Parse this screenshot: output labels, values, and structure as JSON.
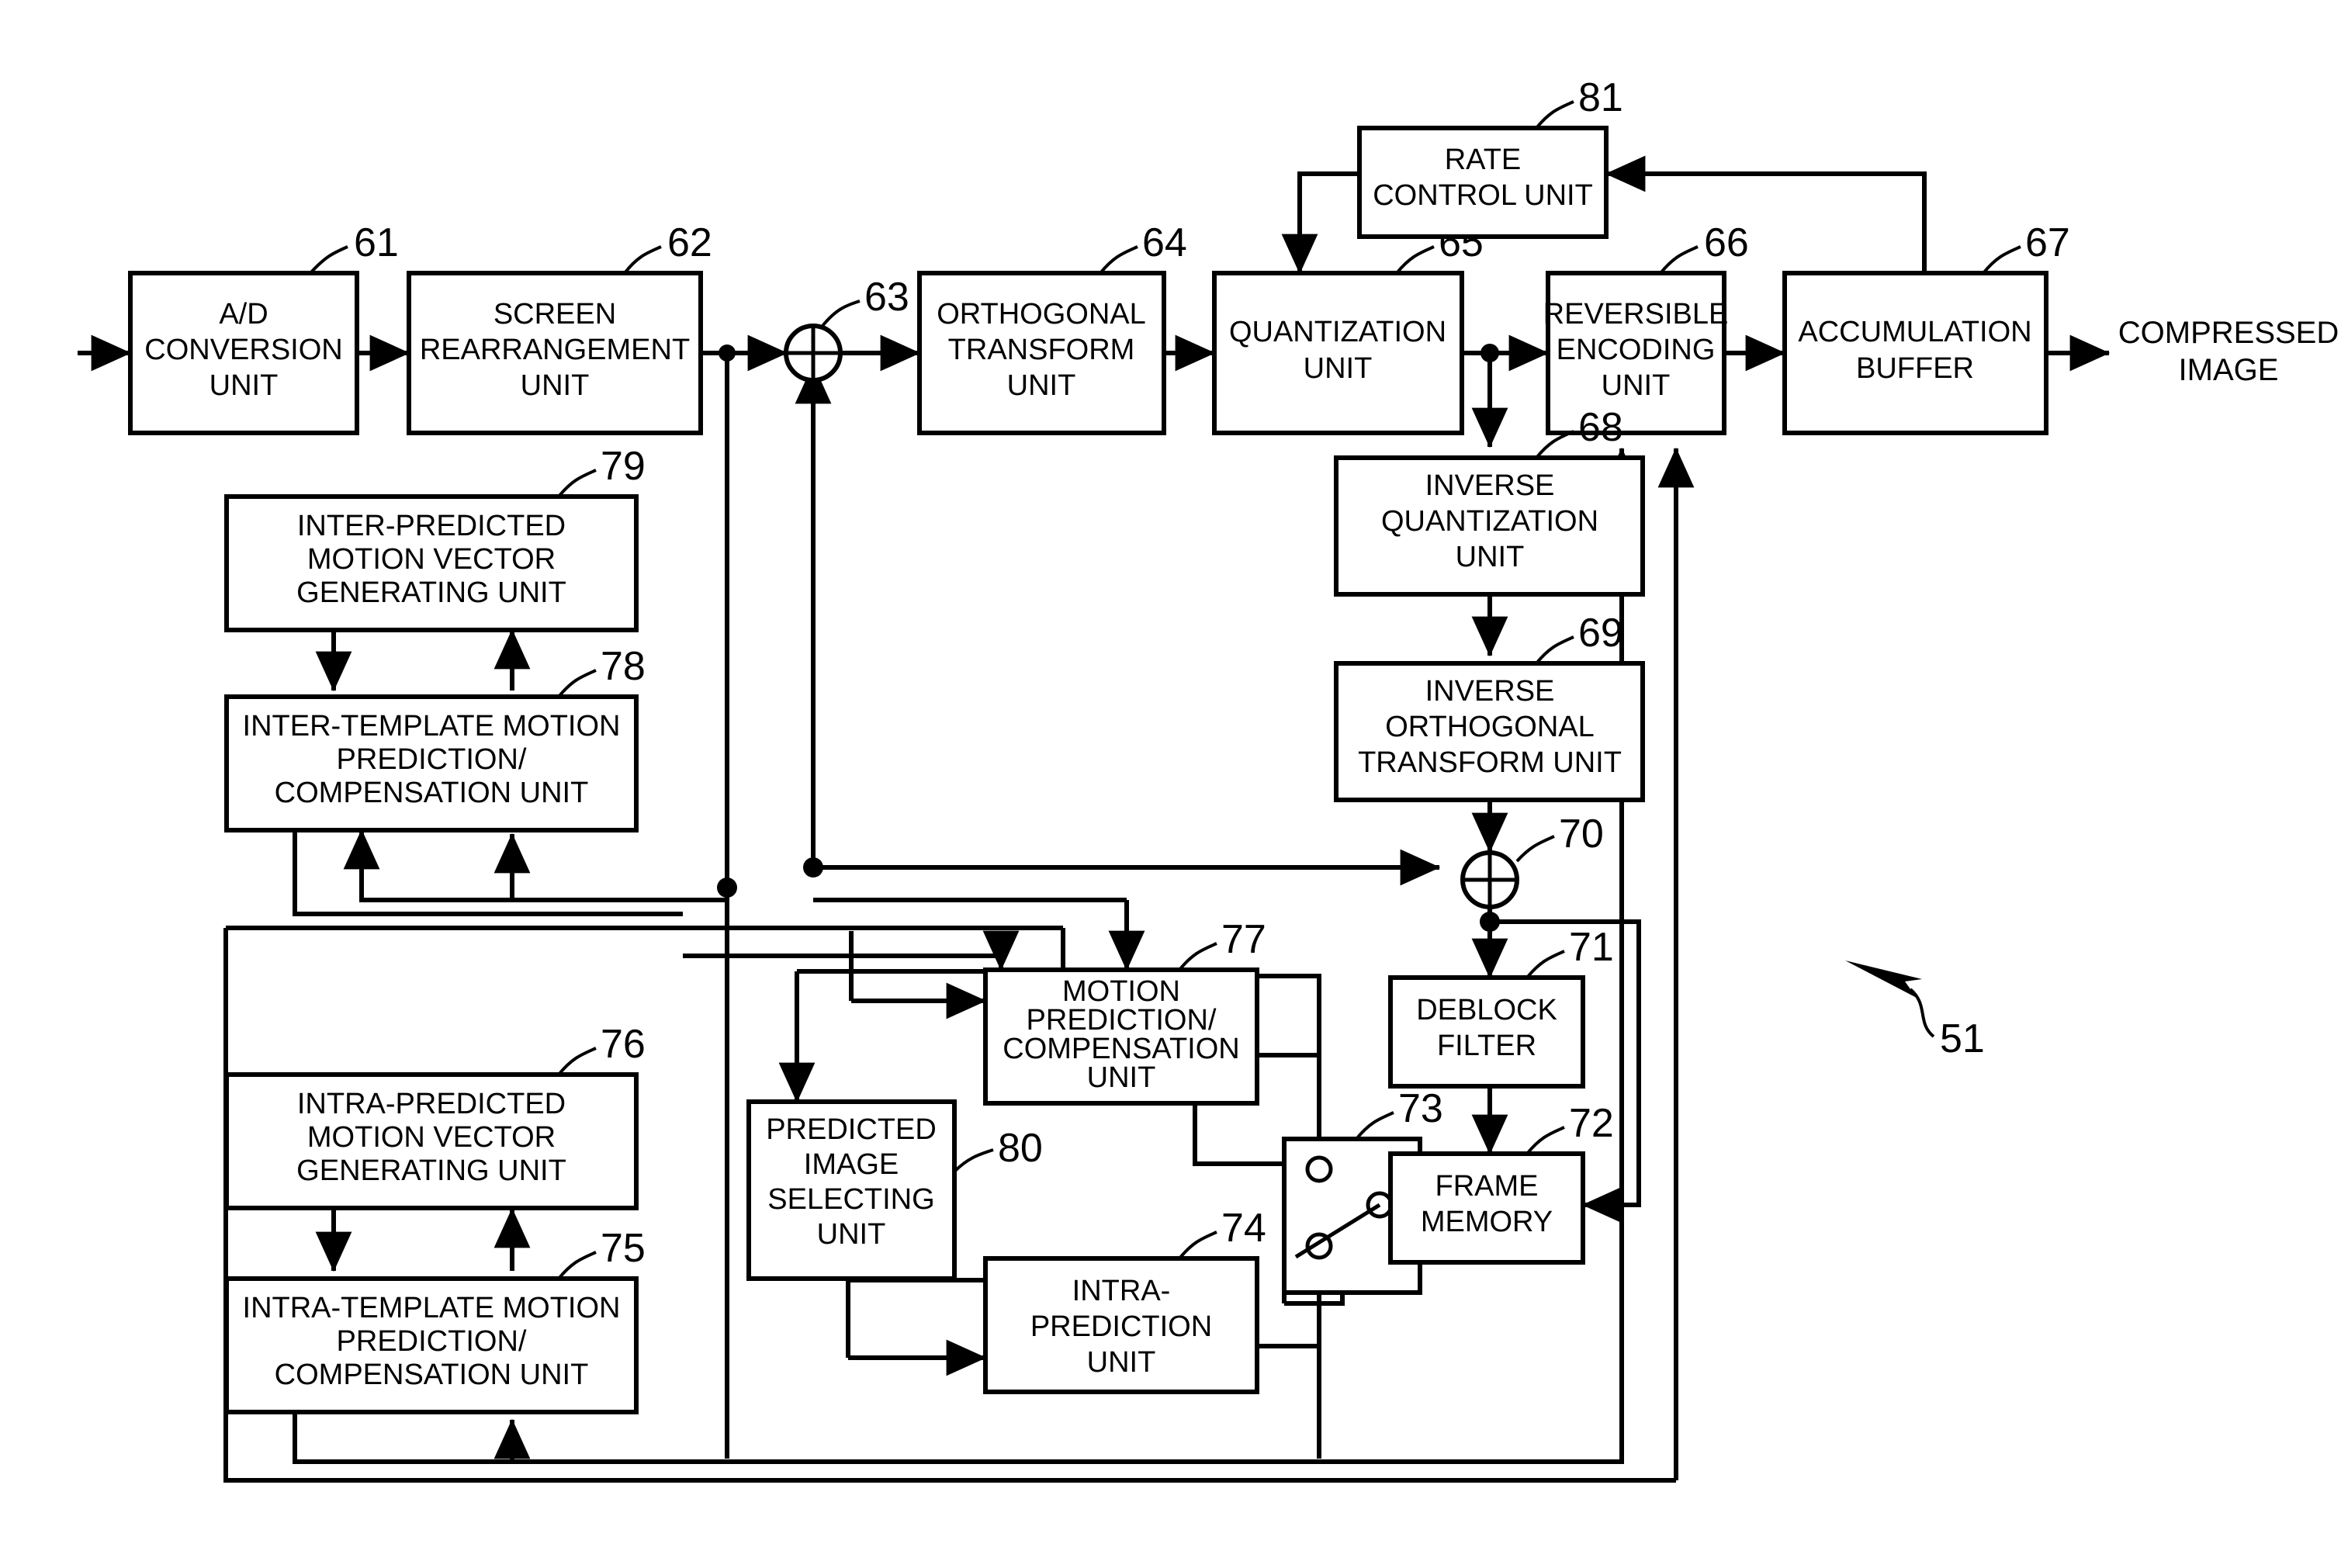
{
  "figure": {
    "reference_numeral": "51",
    "external_labels": [
      {
        "id": "compressed-image",
        "text_line1": "COMPRESSED",
        "text_line2": "IMAGE"
      }
    ]
  },
  "blocks": [
    {
      "id": "ad-conversion-unit",
      "num": "61",
      "lines": [
        "A/D",
        "CONVERSION",
        "UNIT"
      ]
    },
    {
      "id": "screen-rearrangement-unit",
      "num": "62",
      "lines": [
        "SCREEN",
        "REARRANGEMENT",
        "UNIT"
      ]
    },
    {
      "id": "orthogonal-transform-unit",
      "num": "64",
      "lines": [
        "ORTHOGONAL",
        "TRANSFORM",
        "UNIT"
      ]
    },
    {
      "id": "quantization-unit",
      "num": "65",
      "lines": [
        "QUANTIZATION",
        "UNIT"
      ]
    },
    {
      "id": "reversible-encoding-unit",
      "num": "66",
      "lines": [
        "REVERSIBLE",
        "ENCODING",
        "UNIT"
      ]
    },
    {
      "id": "accumulation-buffer",
      "num": "67",
      "lines": [
        "ACCUMULATION",
        "BUFFER"
      ]
    },
    {
      "id": "rate-control-unit",
      "num": "81",
      "lines": [
        "RATE",
        "CONTROL UNIT"
      ]
    },
    {
      "id": "inverse-quantization-unit",
      "num": "68",
      "lines": [
        "INVERSE",
        "QUANTIZATION",
        "UNIT"
      ]
    },
    {
      "id": "inverse-orthogonal-transform-unit",
      "num": "69",
      "lines": [
        "INVERSE",
        "ORTHOGONAL",
        "TRANSFORM UNIT"
      ]
    },
    {
      "id": "deblock-filter",
      "num": "71",
      "lines": [
        "DEBLOCK",
        "FILTER"
      ]
    },
    {
      "id": "frame-memory",
      "num": "72",
      "lines": [
        "FRAME",
        "MEMORY"
      ]
    },
    {
      "id": "inter-predicted-motion-vector-generating-unit",
      "num": "79",
      "lines": [
        "INTER-PREDICTED",
        "MOTION VECTOR",
        "GENERATING UNIT"
      ]
    },
    {
      "id": "inter-template-motion-prediction-compensation-unit",
      "num": "78",
      "lines": [
        "INTER-TEMPLATE MOTION",
        "PREDICTION/",
        "COMPENSATION UNIT"
      ]
    },
    {
      "id": "intra-predicted-motion-vector-generating-unit",
      "num": "76",
      "lines": [
        "INTRA-PREDICTED",
        "MOTION VECTOR",
        "GENERATING UNIT"
      ]
    },
    {
      "id": "intra-template-motion-prediction-compensation-unit",
      "num": "75",
      "lines": [
        "INTRA-TEMPLATE MOTION",
        "PREDICTION/",
        "COMPENSATION UNIT"
      ]
    },
    {
      "id": "motion-prediction-compensation-unit",
      "num": "77",
      "lines": [
        "MOTION",
        "PREDICTION/",
        "COMPENSATION",
        "UNIT"
      ]
    },
    {
      "id": "predicted-image-selecting-unit",
      "num": "80",
      "lines": [
        "PREDICTED",
        "IMAGE",
        "SELECTING",
        "UNIT"
      ]
    },
    {
      "id": "intra-prediction-unit",
      "num": "74",
      "lines": [
        "INTRA-",
        "PREDICTION",
        "UNIT"
      ]
    }
  ],
  "junctions": [
    {
      "id": "adder-63",
      "num": "63"
    },
    {
      "id": "adder-70",
      "num": "70"
    },
    {
      "id": "switch-73",
      "num": "73"
    }
  ],
  "colors": {
    "ink": "#000000",
    "paper": "#ffffff"
  }
}
